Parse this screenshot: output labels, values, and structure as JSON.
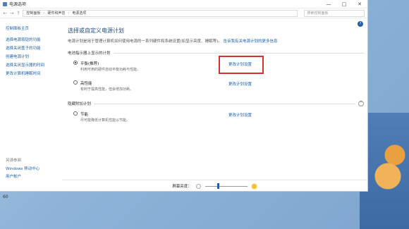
{
  "window": {
    "title": "电源选项",
    "controls": [
      "—",
      "□",
      "✕"
    ]
  },
  "address": {
    "back": "←",
    "forward": "→",
    "up": "↑",
    "crumbs": [
      "控制面板",
      "硬件和声音",
      "电源选项"
    ],
    "search_placeholder": "搜索控制面板"
  },
  "sidebar": {
    "home": "控制面板主页",
    "items": [
      "选择电源按钮的功能",
      "选择关闭盖子的功能",
      "创建电源计划",
      "选择关闭显示器的时间",
      "更改计算机睡眠时间"
    ],
    "see_also_header": "另请参阅",
    "see_also": [
      "Windows 移动中心",
      "用户帐户"
    ]
  },
  "main": {
    "title": "选择或自定义电源计划",
    "desc": "电源计划是用于管理计算机如何使用电源的一系列硬件和系统设置(如显示亮度、睡眠等)。",
    "desc_link": "告诉我有关电源计划的更多信息",
    "section_shown": "电池指示器上显示的计划",
    "section_hidden": "隐藏附加计划",
    "plans": [
      {
        "name": "平衡(推荐)",
        "sub": "利用可用的硬件自动平衡功耗与性能。",
        "change": "更改计划设置",
        "selected": true
      },
      {
        "name": "高性能",
        "sub": "有利于提高性能，但会增加功耗。",
        "change": "更改计划设置",
        "selected": false
      },
      {
        "name": "节能",
        "sub": "尽可能降低计算机性能以节能。",
        "change": "更改计划设置",
        "selected": false
      }
    ]
  },
  "bottom": {
    "brightness_label": "屏幕亮度：",
    "brightness_level": 0.3
  },
  "help": "?",
  "taskbar_num": "60"
}
